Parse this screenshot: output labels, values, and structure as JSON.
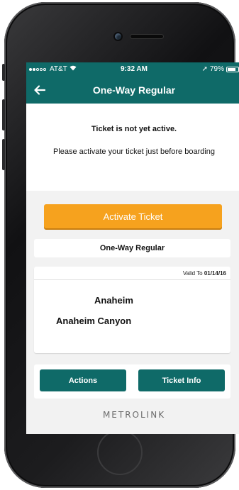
{
  "status_bar": {
    "carrier": "AT&T",
    "wifi_icon": "wifi-icon",
    "time": "9:32 AM",
    "location_icon": "➚",
    "battery_text": "79%",
    "battery_level": 0.79
  },
  "nav": {
    "back_icon": "arrow-left-icon",
    "title": "One-Way Regular"
  },
  "notice": {
    "title": "Ticket is not yet active.",
    "body": "Please activate your ticket just before boarding"
  },
  "activate_button": {
    "label": "Activate Ticket"
  },
  "ticket": {
    "type": "One-Way Regular",
    "valid_prefix": "Valid To",
    "valid_date": "01/14/16",
    "origin": "Anaheim",
    "destination": "Anaheim Canyon"
  },
  "actions": {
    "actions_label": "Actions",
    "ticket_info_label": "Ticket Info"
  },
  "brand": {
    "logo_text": "METROLINK"
  },
  "colors": {
    "header": "#0f6a68",
    "accent": "#f6a21e",
    "background": "#f2f2f2"
  }
}
